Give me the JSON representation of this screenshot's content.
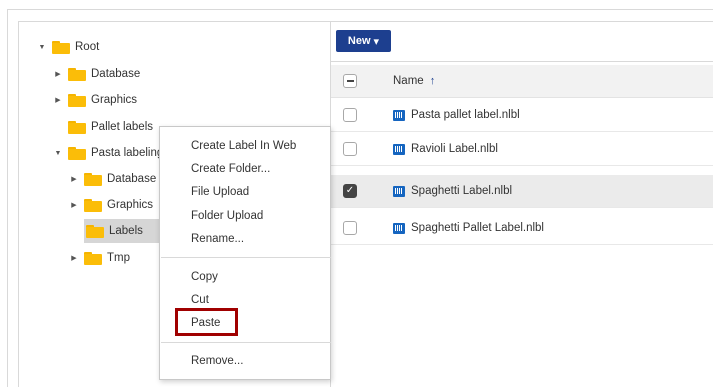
{
  "tree": {
    "items": [
      {
        "label": "Root",
        "caret": "▼"
      },
      {
        "label": "Database",
        "caret": "▶"
      },
      {
        "label": "Graphics",
        "caret": "▶"
      },
      {
        "label": "Pallet labels",
        "caret": ""
      },
      {
        "label": "Pasta labeling",
        "caret": "▼"
      },
      {
        "label": "Database",
        "caret": "▶"
      },
      {
        "label": "Graphics",
        "caret": "▶"
      },
      {
        "label": "Labels",
        "caret": ""
      },
      {
        "label": "Tmp",
        "caret": "▶"
      }
    ]
  },
  "toolbar": {
    "new_label": "New",
    "new_caret": "▾"
  },
  "list": {
    "header": {
      "name": "Name",
      "sort_icon": "↑"
    },
    "rows": [
      {
        "name": "Pasta pallet label.nlbl",
        "checked": false
      },
      {
        "name": "Ravioli Label.nlbl",
        "checked": false
      },
      {
        "name": "Spaghetti Label.nlbl",
        "checked": true
      },
      {
        "name": "Spaghetti Pallet Label.nlbl",
        "checked": false
      }
    ]
  },
  "context_menu": {
    "items": [
      "Create Label In Web",
      "Create Folder...",
      "File Upload",
      "Folder Upload",
      "Rename...",
      "Copy",
      "Cut",
      "Paste",
      "Remove..."
    ]
  },
  "colors": {
    "accent": "#1d3f8f",
    "folder": "#fbbd08",
    "highlight": "#a00000"
  }
}
